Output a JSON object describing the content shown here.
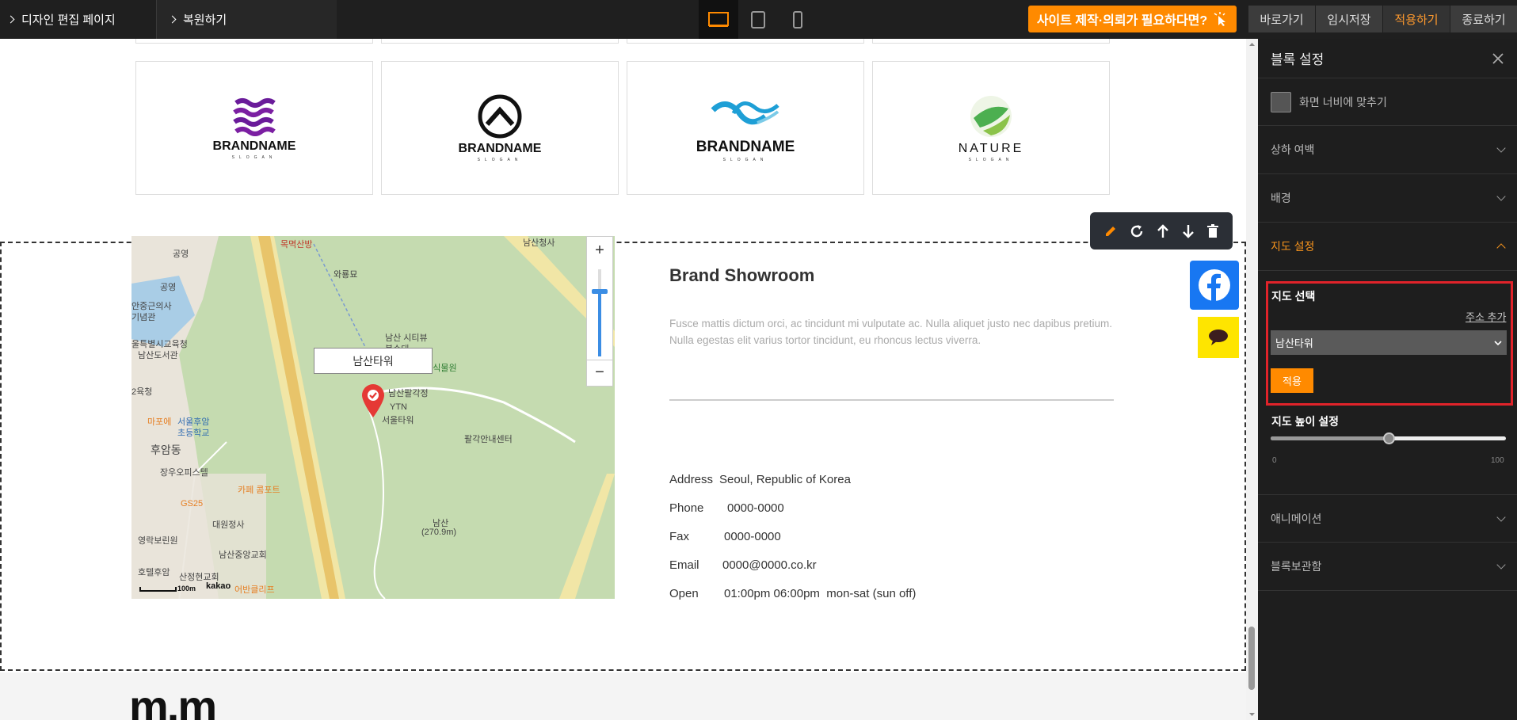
{
  "topbar": {
    "design_edit": "디자인 편집 페이지",
    "restore": "복원하기",
    "cta": "사이트 제작·의뢰가 필요하다면?",
    "buttons": {
      "goto": "바로가기",
      "temp_save": "임시저장",
      "apply": "적용하기",
      "exit": "종료하기"
    }
  },
  "logos": [
    {
      "brand": "BRANDNAME",
      "slogan": "SLOGAN",
      "icon": "wave-grid-icon",
      "color": "#6a1b9a"
    },
    {
      "brand": "BRANDNAME",
      "slogan": "SLOGAN",
      "icon": "house-circle-icon",
      "color": "#111111"
    },
    {
      "brand": "BRANDNAME",
      "slogan": "SLOGAN",
      "icon": "wave-icon",
      "color": "#1e9fd6"
    },
    {
      "brand": "NATURE",
      "slogan": "SLOGAN",
      "icon": "leaf-icon",
      "color": "#4caf50"
    }
  ],
  "map": {
    "marker_label": "남산타워",
    "labels": [
      "목멱산방",
      "남산청사",
      "공영",
      "와룡묘",
      "공영",
      "안중근의사",
      "기념관",
      "울특별시교육청",
      "남산도서관",
      "남산 시티뷰",
      "봉수대",
      "야외식물원",
      "남산팔각정",
      "YTN",
      "서울타워",
      "팔각안내센터",
      "2육청",
      "마포에",
      "서울후암",
      "초등학교",
      "후암동",
      "장우오피스텔",
      "카페 콤포트",
      "GS25",
      "대원정사",
      "영락보린원",
      "남산중앙교회",
      "남산",
      "(270.9m)",
      "호텔후암",
      "산정현교회",
      "어반클리프",
      "kakao",
      "100m"
    ],
    "zoom_plus": "+",
    "zoom_minus": "−",
    "zoom_level": 0.75
  },
  "info": {
    "title": "Brand Showroom",
    "desc1": "Fusce mattis dictum orci, ac tincidunt mi vulputate ac. Nulla aliquet justo nec dapibus pretium.",
    "desc2": "Nulla egestas elit varius tortor tincidunt, eu rhoncus lectus viverra.",
    "rows": [
      {
        "k": "Address",
        "v": "Seoul, Republic of Korea"
      },
      {
        "k": "Phone",
        "v": "0000-0000"
      },
      {
        "k": "Fax",
        "v": "0000-0000"
      },
      {
        "k": "Email",
        "v": "0000@0000.co.kr"
      },
      {
        "k": "Open",
        "v": "01:00pm 06:00pm  mon-sat (sun off)"
      }
    ]
  },
  "footer_logo": "m.m",
  "panel": {
    "title": "블록 설정",
    "fit_width": "화면 너비에 맞추기",
    "padding": "상하 여백",
    "background": "배경",
    "map_settings": "지도 설정",
    "map_select": "지도 선택",
    "add_address": "주소 추가",
    "selected": "남산타워",
    "apply": "적용",
    "map_height": "지도 높이 설정",
    "min": "0",
    "max": "100",
    "height_value": 0.5,
    "animation": "애니메이션",
    "block_storage": "블록보관함"
  },
  "colors": {
    "accent": "#ff8a00",
    "highlight": "#e0232a",
    "facebook": "#1877f2",
    "kakao": "#fee500"
  }
}
